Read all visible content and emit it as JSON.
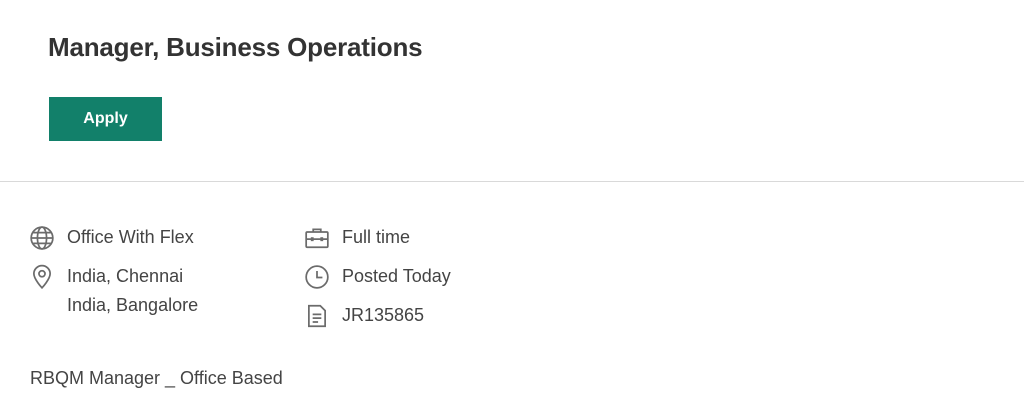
{
  "job": {
    "title": "Manager, Business Operations",
    "apply_label": "Apply"
  },
  "details": {
    "work_mode": {
      "icon": "globe-icon",
      "text": "Office With Flex"
    },
    "locations": {
      "icon": "map-pin-icon",
      "items": [
        "India, Chennai",
        "India, Bangalore"
      ]
    },
    "employment_type": {
      "icon": "briefcase-icon",
      "text": "Full time"
    },
    "posted": {
      "icon": "clock-icon",
      "text": "Posted Today"
    },
    "requisition_id": {
      "icon": "document-icon",
      "text": "JR135865"
    }
  },
  "summary": "RBQM Manager _ Office Based",
  "colors": {
    "accent": "#12806a",
    "text": "#333333",
    "divider": "#d9d9d9"
  }
}
